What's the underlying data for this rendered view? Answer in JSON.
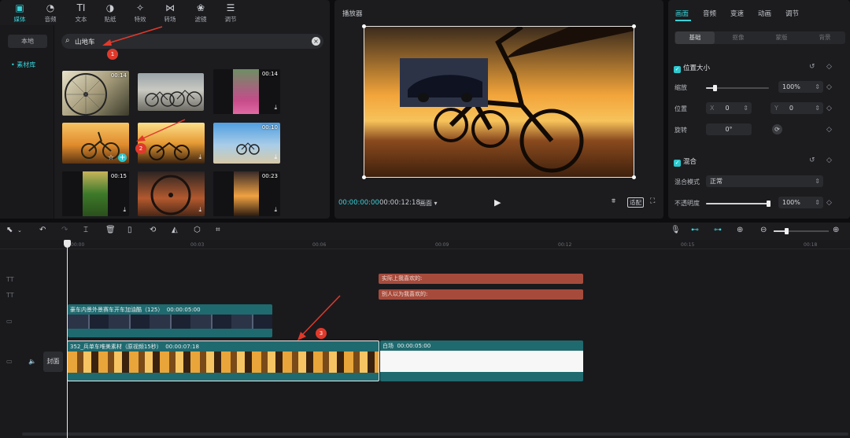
{
  "media_panel": {
    "tabs": [
      {
        "label": "媒体",
        "icon": "media-icon"
      },
      {
        "label": "音频",
        "icon": "audio-icon"
      },
      {
        "label": "文本",
        "icon": "text-icon"
      },
      {
        "label": "贴纸",
        "icon": "sticker-icon"
      },
      {
        "label": "特效",
        "icon": "effects-icon"
      },
      {
        "label": "转场",
        "icon": "transition-icon"
      },
      {
        "label": "滤镜",
        "icon": "filter-icon"
      },
      {
        "label": "调节",
        "icon": "adjust-icon"
      }
    ],
    "sidebar": {
      "local": "本地",
      "library": "• 素材库"
    },
    "search": {
      "value": "山地车"
    },
    "thumbs": [
      {
        "duration": "00:14"
      },
      {
        "duration": ""
      },
      {
        "duration": "00:14"
      },
      {
        "duration": ""
      },
      {
        "duration": ""
      },
      {
        "duration": "00:10"
      },
      {
        "duration": "00:15"
      },
      {
        "duration": ""
      },
      {
        "duration": "00:23"
      }
    ]
  },
  "player": {
    "title": "播放器",
    "time_current": "00:00:00:00",
    "time_total": "00:00:12:18",
    "ratio": "画面 ▾",
    "fullscreen_label": "适配"
  },
  "properties": {
    "tabs": [
      "画面",
      "音频",
      "变速",
      "动画",
      "调节"
    ],
    "subtabs": [
      "基础",
      "抠像",
      "蒙版",
      "背景"
    ],
    "position_size_title": "位置大小",
    "scale_label": "缩放",
    "scale_value": "100%",
    "scale_fraction": 0.15,
    "position_label": "位置",
    "pos_x_label": "X",
    "pos_x": "0",
    "pos_y_label": "Y",
    "pos_y": "0",
    "rotate_label": "旋转",
    "rotate_value": "0°",
    "blend_title": "混合",
    "blend_mode_label": "混合模式",
    "blend_mode_value": "正常",
    "opacity_label": "不透明度",
    "opacity_value": "100%",
    "opacity_fraction": 1.0
  },
  "timeline": {
    "ticks": [
      "00:00",
      "00:03",
      "00:06",
      "00:09",
      "00:12",
      "00:15",
      "00:18"
    ],
    "text_clips": [
      "实际上我喜欢的:",
      "别人以为我喜欢的:"
    ],
    "clip_top": {
      "title": "豪车内景外景赛车开车加油酷（125）",
      "duration": "00:00:05:00"
    },
    "clip_main": {
      "title": "352_兵单车唯美素材（原视频15秒）",
      "duration": "00:00:07:18"
    },
    "clip_white": {
      "title": "白场",
      "duration": "00:00:05:00"
    },
    "cover_label": "封面"
  },
  "annotations": [
    "1",
    "2",
    "3"
  ],
  "colors": {
    "accent": "#36d3d8",
    "text_clip": "#a64b3c",
    "clip_teal": "#1f6a6f"
  }
}
